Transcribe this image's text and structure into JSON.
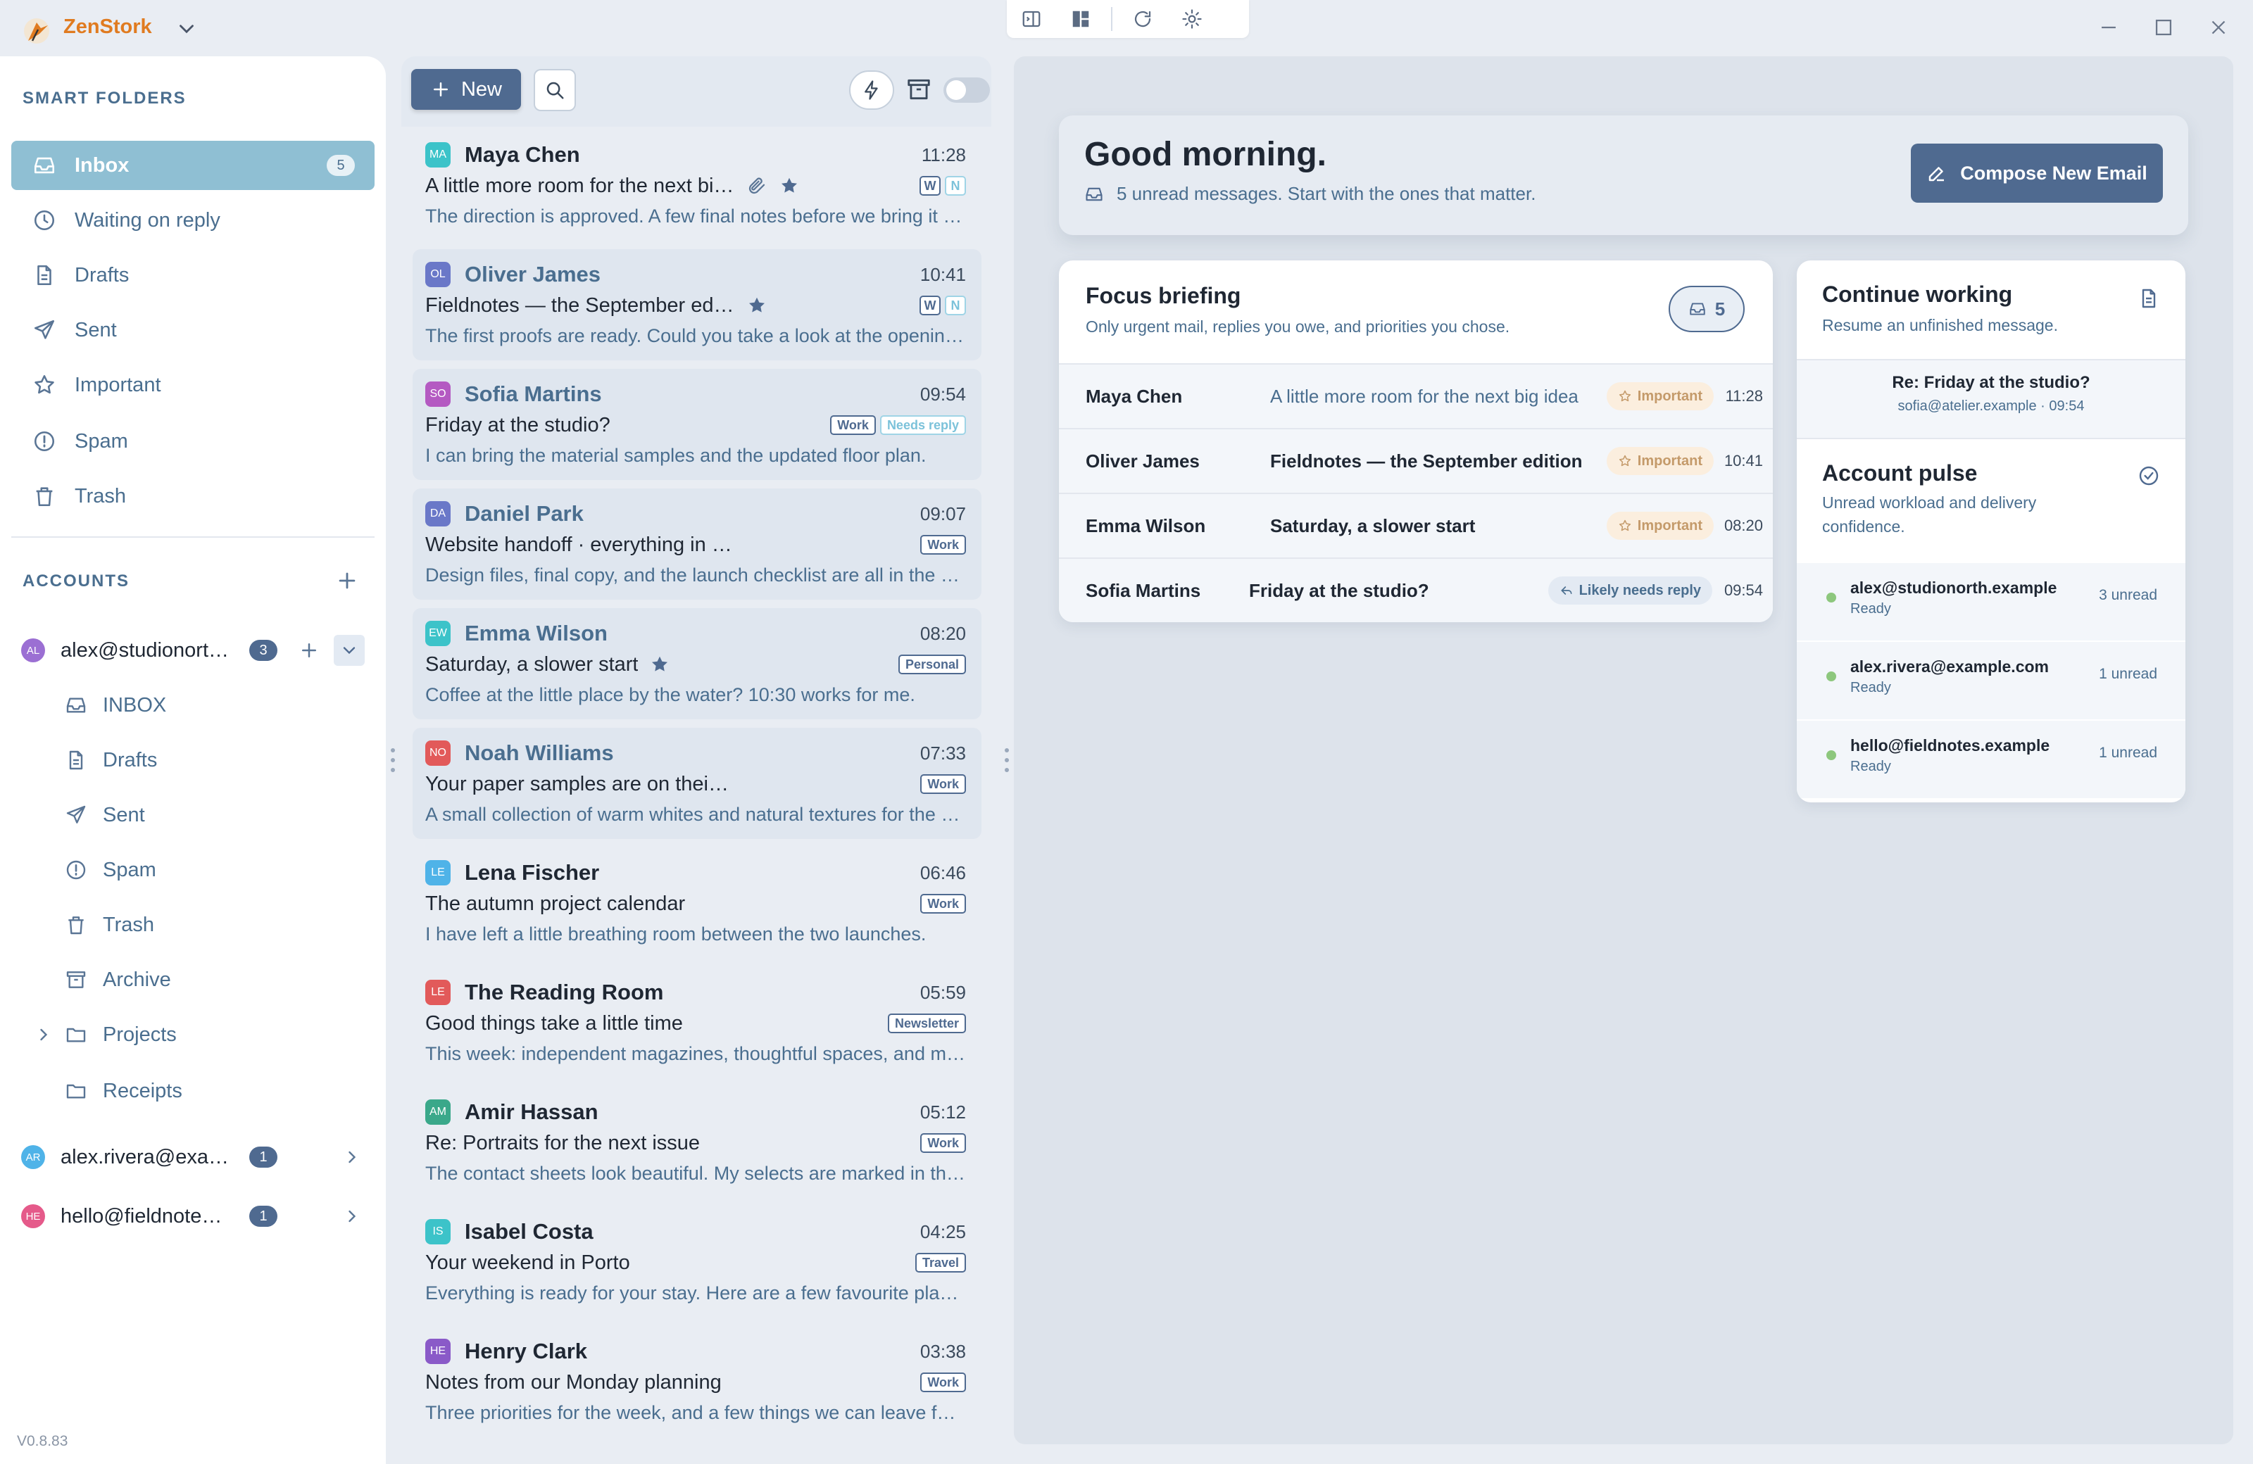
{
  "app": {
    "name": "ZenStork",
    "version": "V0.8.83"
  },
  "sidebar": {
    "smart_header": "SMART FOLDERS",
    "smart": [
      {
        "label": "Inbox",
        "icon": "inbox-icon",
        "count": "5"
      },
      {
        "label": "Waiting on reply",
        "icon": "clock-icon"
      },
      {
        "label": "Drafts",
        "icon": "file-icon"
      },
      {
        "label": "Sent",
        "icon": "send-icon"
      },
      {
        "label": "Important",
        "icon": "star-icon"
      },
      {
        "label": "Spam",
        "icon": "alert-icon"
      },
      {
        "label": "Trash",
        "icon": "trash-icon"
      }
    ],
    "accounts_header": "ACCOUNTS",
    "accounts": [
      {
        "initials": "AL",
        "name": "alex@studionorth.example",
        "count": "3",
        "color": "#9b6fd3"
      },
      {
        "initials": "AR",
        "name": "alex.rivera@example.com",
        "count": "1",
        "color": "#4fb3e8"
      },
      {
        "initials": "HE",
        "name": "hello@fieldnotes.example",
        "count": "1",
        "color": "#e55a8a"
      }
    ],
    "folders": [
      {
        "label": "INBOX",
        "icon": "inbox-icon"
      },
      {
        "label": "Drafts",
        "icon": "file-icon"
      },
      {
        "label": "Sent",
        "icon": "send-icon"
      },
      {
        "label": "Spam",
        "icon": "alert-icon"
      },
      {
        "label": "Trash",
        "icon": "trash-icon"
      },
      {
        "label": "Archive",
        "icon": "archive-icon"
      },
      {
        "label": "Projects",
        "icon": "folder-icon"
      },
      {
        "label": "Receipts",
        "icon": "folder-icon"
      }
    ]
  },
  "list": {
    "new_label": "New",
    "mails": [
      {
        "initials": "MA",
        "color": "#3cc3c9",
        "sender": "Maya Chen",
        "time": "11:28",
        "subject": "A little more room for the next big idea",
        "preview": "The direction is approved. A few final notes before we bring it to the team.",
        "tags": [
          "W",
          "N"
        ],
        "attach": true,
        "star": true,
        "unread": false
      },
      {
        "initials": "OL",
        "color": "#6a78c8",
        "sender": "Oliver James",
        "time": "10:41",
        "subject": "Fieldnotes — the September edition",
        "preview": "The first proofs are ready. Could you take a look at the opening spread?",
        "tags": [
          "W",
          "N"
        ],
        "star": true,
        "unread": true
      },
      {
        "initials": "SO",
        "color": "#b45ac2",
        "sender": "Sofia Martins",
        "time": "09:54",
        "subject": "Friday at the studio?",
        "preview": "I can bring the material samples and the updated floor plan.",
        "tags": [
          "Work",
          "Needs reply"
        ],
        "unread": true
      },
      {
        "initials": "DA",
        "color": "#6a78c8",
        "sender": "Daniel Park",
        "time": "09:07",
        "subject": "Website handoff · everything in one place",
        "preview": "Design files, final copy, and the launch checklist are all in the project folder.",
        "tags": [
          "Work"
        ],
        "unread": true
      },
      {
        "initials": "EW",
        "color": "#3cc3c9",
        "sender": "Emma Wilson",
        "time": "08:20",
        "subject": "Saturday, a slower start",
        "preview": "Coffee at the little place by the water? 10:30 works for me.",
        "tags": [
          "Personal"
        ],
        "star": true,
        "unread": true
      },
      {
        "initials": "NO",
        "color": "#e25a5a",
        "sender": "Noah Williams",
        "time": "07:33",
        "subject": "Your paper samples are on their way",
        "preview": "A small collection of warm whites and natural textures for the new identity.",
        "tags": [
          "Work"
        ],
        "unread": true
      },
      {
        "initials": "LE",
        "color": "#4fb3e8",
        "sender": "Lena Fischer",
        "time": "06:46",
        "subject": "The autumn project calendar",
        "preview": "I have left a little breathing room between the two launches.",
        "tags": [
          "Work"
        ],
        "unread": false
      },
      {
        "initials": "LE",
        "color": "#e25a5a",
        "sender": "The Reading Room",
        "time": "05:59",
        "subject": "Good things take a little time",
        "preview": "This week: independent magazines, thoughtful spaces, and more.",
        "tags": [
          "Newsletter"
        ],
        "unread": false
      },
      {
        "initials": "AM",
        "color": "#3aa88a",
        "sender": "Amir Hassan",
        "time": "05:12",
        "subject": "Re: Portraits for the next issue",
        "preview": "The contact sheets look beautiful. My selects are marked in the shared folder.",
        "tags": [
          "Work"
        ],
        "unread": false
      },
      {
        "initials": "IS",
        "color": "#3cc3c9",
        "sender": "Isabel Costa",
        "time": "04:25",
        "subject": "Your weekend in Porto",
        "preview": "Everything is ready for your stay. Here are a few favourite places nearby.",
        "tags": [
          "Travel"
        ],
        "unread": false
      },
      {
        "initials": "HE",
        "color": "#8a5ac8",
        "sender": "Henry Clark",
        "time": "03:38",
        "subject": "Notes from our Monday planning",
        "preview": "Three priorities for the week, and a few things we can leave for later.",
        "tags": [
          "Work"
        ],
        "unread": false
      }
    ]
  },
  "main": {
    "greeting": "Good morning.",
    "greeting_sub": "5 unread messages. Start with the ones that matter.",
    "compose_label": "Compose New Email",
    "focus": {
      "title": "Focus briefing",
      "subtitle": "Only urgent mail, replies you owe, and priorities you chose.",
      "count": "5",
      "rows": [
        {
          "sender": "Maya Chen",
          "subject": "A little more room for the next big idea",
          "pill": "Important",
          "time": "11:28",
          "bold": false
        },
        {
          "sender": "Oliver James",
          "subject": "Fieldnotes — the September edition",
          "pill": "Important",
          "time": "10:41",
          "bold": true
        },
        {
          "sender": "Emma Wilson",
          "subject": "Saturday, a slower start",
          "pill": "Important",
          "time": "08:20",
          "bold": true
        },
        {
          "sender": "Sofia Martins",
          "subject": "Friday at the studio?",
          "pill": "Likely needs reply",
          "time": "09:54",
          "bold": true
        }
      ]
    },
    "continue": {
      "title": "Continue working",
      "subtitle": "Resume an unfinished message.",
      "draft_title": "Re: Friday at the studio?",
      "draft_meta": "sofia@atelier.example · 09:54"
    },
    "pulse": {
      "title": "Account pulse",
      "subtitle": "Unread workload and delivery confidence.",
      "rows": [
        {
          "account": "alex@studionorth.example",
          "status": "Ready",
          "unread": "3 unread"
        },
        {
          "account": "alex.rivera@example.com",
          "status": "Ready",
          "unread": "1 unread"
        },
        {
          "account": "hello@fieldnotes.example",
          "status": "Ready",
          "unread": "1 unread"
        }
      ]
    }
  }
}
